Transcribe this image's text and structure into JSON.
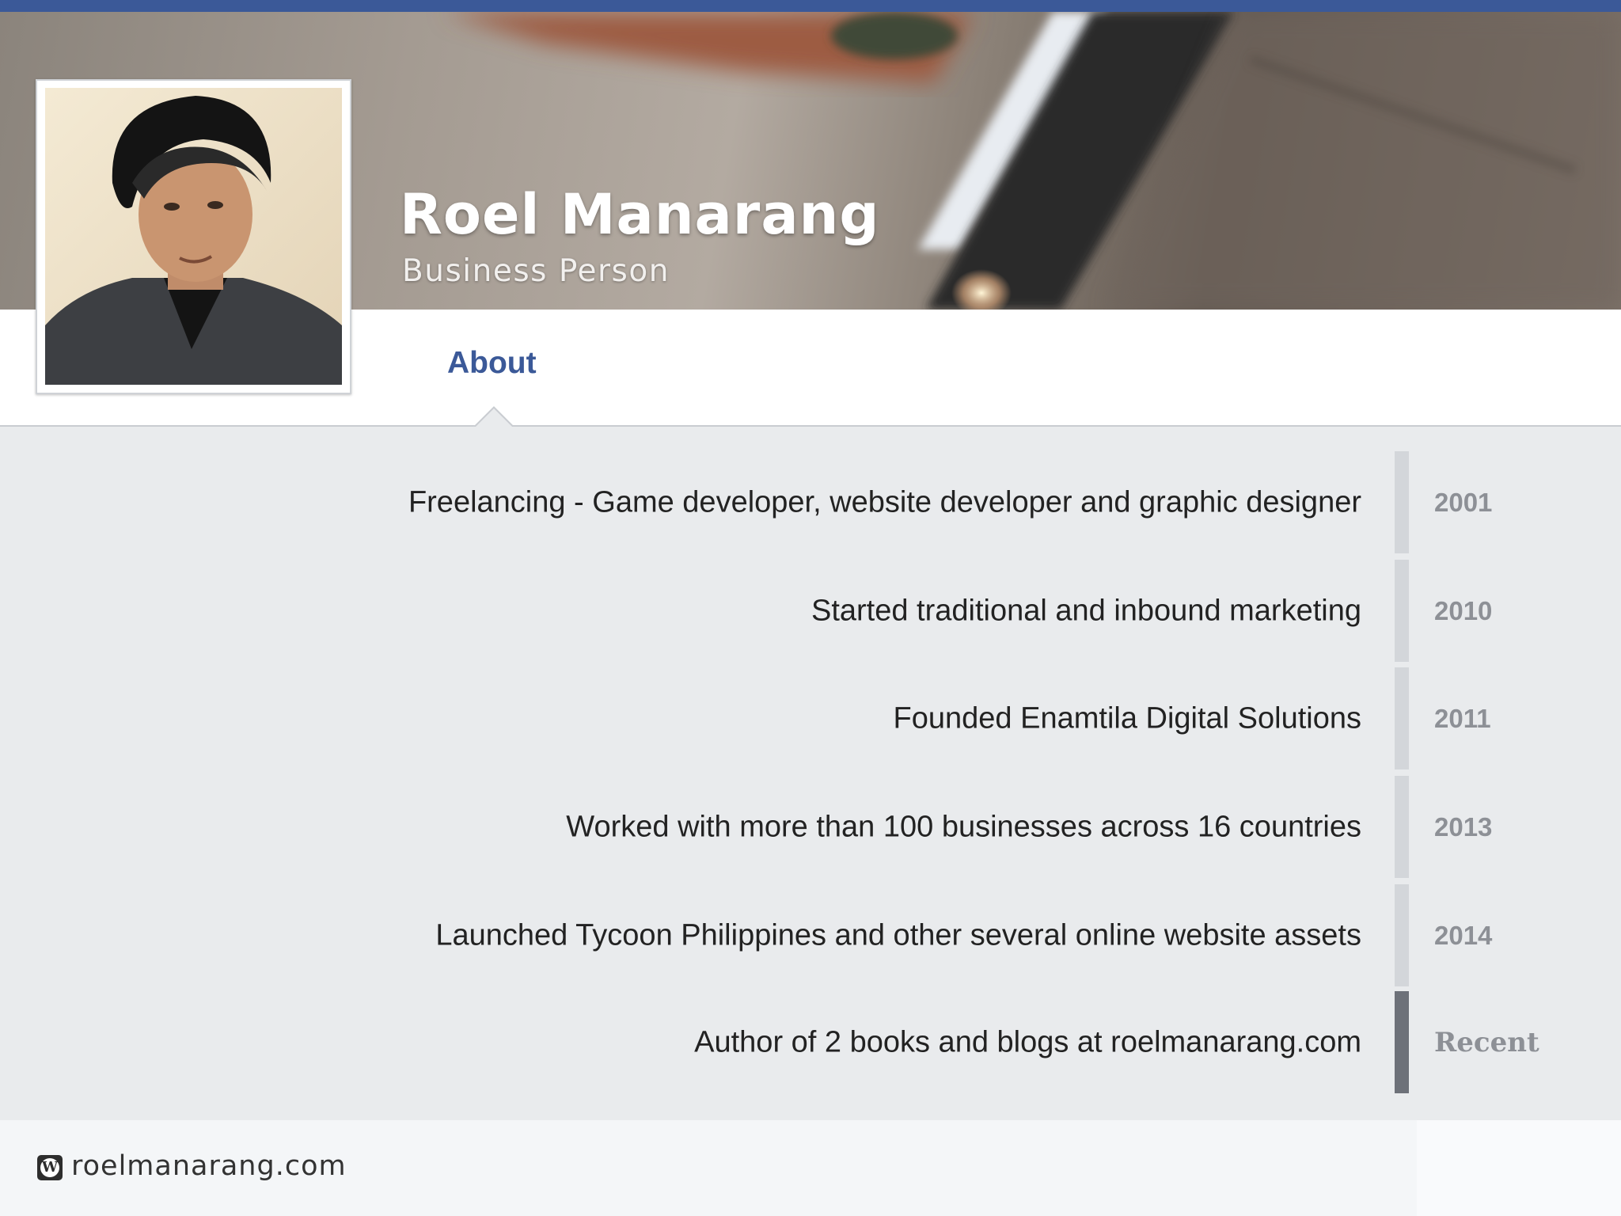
{
  "profile": {
    "name": "Roel Manarang",
    "title": "Business Person"
  },
  "tabs": [
    {
      "label": "About",
      "active": true
    }
  ],
  "timeline": [
    {
      "text": "Freelancing - Game developer, website developer and graphic designer",
      "year": "2001"
    },
    {
      "text": "Started traditional and inbound marketing",
      "year": "2010"
    },
    {
      "text": "Founded Enamtila Digital Solutions",
      "year": "2011"
    },
    {
      "text": "Worked with more than 100 businesses across 16 countries",
      "year": "2013"
    },
    {
      "text": "Launched Tycoon Philippines and other several online website assets",
      "year": "2014"
    },
    {
      "text": "Author of 2 books and blogs at roelmanarang.com",
      "year": "Recent",
      "active": true
    }
  ],
  "footer": {
    "icon": "wordpress-icon",
    "url": "roelmanarang.com"
  },
  "colors": {
    "brand_blue": "#3b5998",
    "timeline_bar": "#d3d6da",
    "timeline_bar_active": "#6d7179",
    "page_background": "#e9ebed"
  }
}
